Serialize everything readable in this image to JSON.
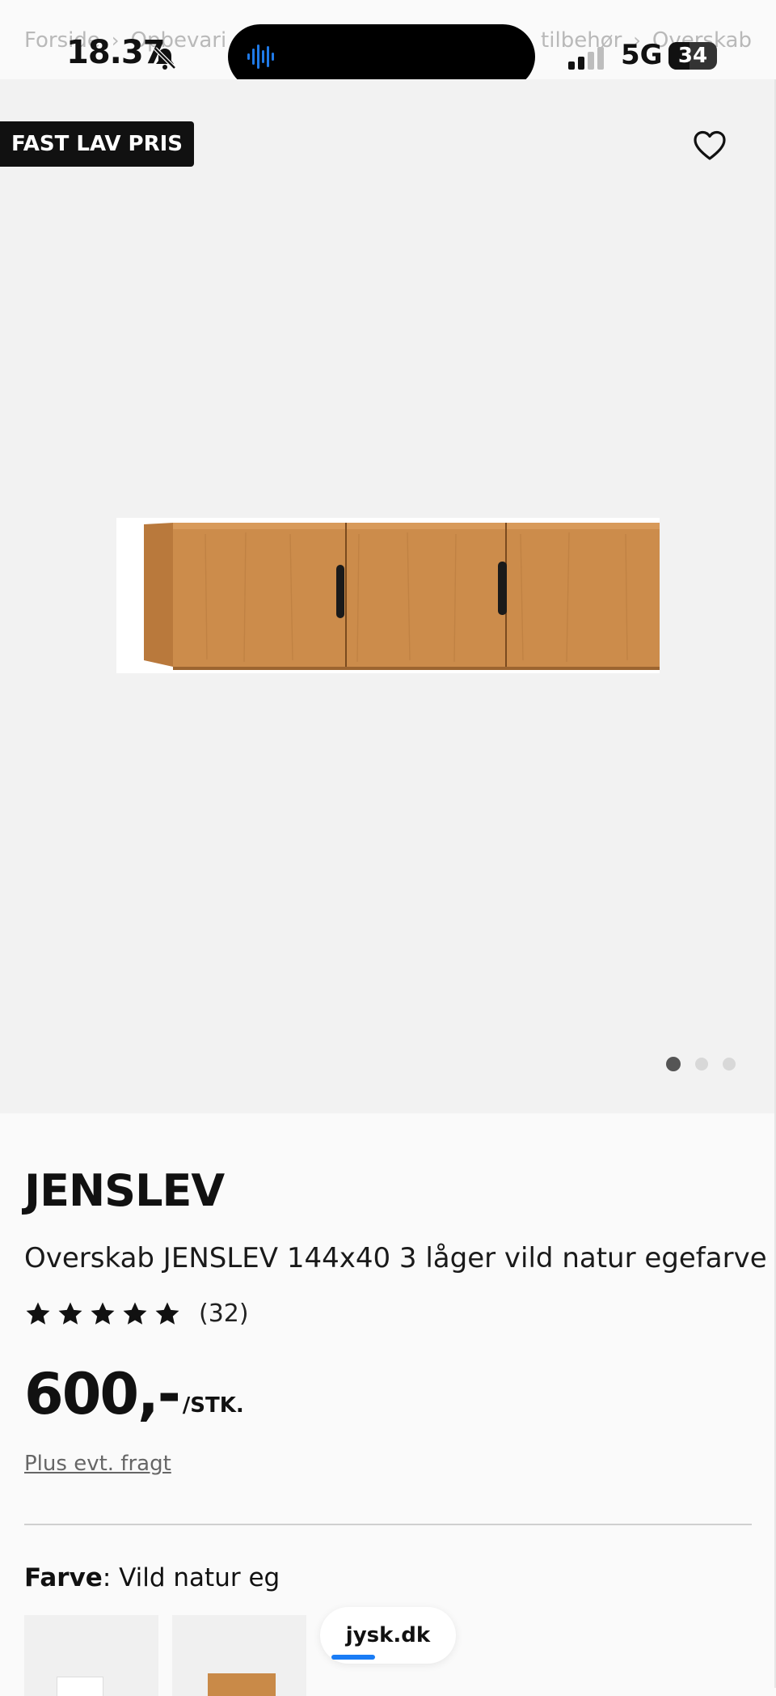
{
  "status_bar": {
    "time": "18.37",
    "network": "5G",
    "battery": "34"
  },
  "breadcrumb": {
    "items": [
      "Forside",
      "Opbevari",
      "tilbehør",
      "Overskab"
    ]
  },
  "hero": {
    "badge": "FAST LAV PRIS",
    "image_count": 3,
    "active_image": 1
  },
  "product": {
    "brand": "JENSLEV",
    "title": "Overskab JENSLEV 144x40 3 låger vild natur egefarve",
    "rating_stars": 5,
    "review_count": "(32)",
    "price": "600,-",
    "unit": "/STK.",
    "freight_link": "Plus evt. fragt",
    "color_label": "Farve",
    "color_value": ": Vild natur eg"
  },
  "browser": {
    "url": "jysk.dk"
  },
  "colors": {
    "badge_bg": "#111111",
    "hero_bg": "#f2f2f2",
    "oak": "#c98a48",
    "progress": "#1a7cf5"
  }
}
